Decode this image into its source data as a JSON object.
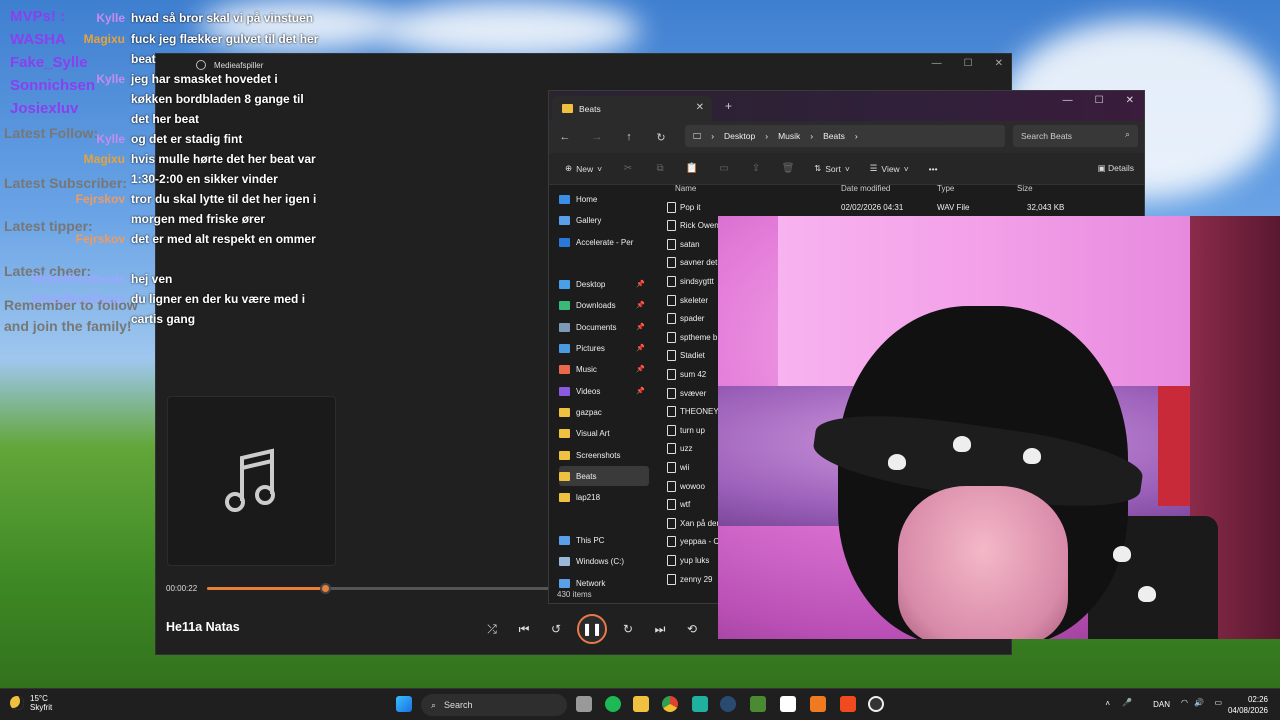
{
  "overlay": {
    "names": [
      "MVPs! :",
      "WASHA",
      "Fake_Sylle",
      "Sonnichsen",
      "Josiexluv"
    ],
    "latest_follow": "Latest Follow:",
    "latest_subscriber": "Latest Subscriber:",
    "latest_tipper": "Latest tipper:",
    "latest_cheer": "Latest cheer:",
    "reminder": "Remember to follow and join the family!"
  },
  "chat": [
    {
      "user": "Kylle",
      "color": "#c58bf0",
      "text": "hvad så bror skal vi på vinstuen"
    },
    {
      "user": "Magixu",
      "color": "#e8a23a",
      "text": "fuck jeg flækker gulvet til det her beat"
    },
    {
      "user": "Kylle",
      "color": "#c58bf0",
      "text": "jeg har smasket hovedet i køkken bordbladen 8 gange til det her beat"
    },
    {
      "user": "Kylle",
      "color": "#c58bf0",
      "text": "og det er stadig fint"
    },
    {
      "user": "Magixu",
      "color": "#e8a23a",
      "text": "hvis mulle hørte det her beat var 1:30-2:00 en sikker vinder"
    },
    {
      "user": "Fejrskov",
      "color": "#f09a60",
      "text": "tror du skal lytte til det her igen i morgen med friske ører"
    },
    {
      "user": "Fejrskov",
      "color": "#f09a60",
      "text": "det er med alt respekt en ommer"
    },
    {
      "user": "WhiteWestDuals",
      "color": "#9aa7ff",
      "text": "hej ven"
    },
    {
      "user": "WhiteWestDuals",
      "color": "#9aa7ff",
      "text": "du ligner en der ku være med i cartis gang"
    }
  ],
  "media_player": {
    "title": "Medieafspiller",
    "elapsed": "00:00:22",
    "progress_fraction": 0.21,
    "track": "He11a Natas",
    "accent": "#e8803a"
  },
  "explorer": {
    "tab_title": "Beats",
    "breadcrumb": [
      "Desktop",
      "Musik",
      "Beats"
    ],
    "search_placeholder": "Search Beats",
    "toolbar": {
      "new": "New",
      "sort": "Sort",
      "view": "View",
      "details": "Details"
    },
    "columns": [
      "Name",
      "Date modified",
      "Type",
      "Size"
    ],
    "sidebar": [
      {
        "label": "Home",
        "color": "#3a8ee6",
        "pin": false
      },
      {
        "label": "Gallery",
        "color": "#5aa0e8",
        "pin": false
      },
      {
        "label": "Accelerate - Per",
        "color": "#2a78d8",
        "pin": false
      },
      {
        "label": "Desktop",
        "color": "#4aa0e8",
        "pin": true
      },
      {
        "label": "Downloads",
        "color": "#3ab87a",
        "pin": true
      },
      {
        "label": "Documents",
        "color": "#7a9ab8",
        "pin": true
      },
      {
        "label": "Pictures",
        "color": "#4a9ae0",
        "pin": true
      },
      {
        "label": "Music",
        "color": "#e86a4a",
        "pin": true
      },
      {
        "label": "Videos",
        "color": "#8a5ae0",
        "pin": true
      },
      {
        "label": "gazpac",
        "color": "#f0c040",
        "pin": false
      },
      {
        "label": "Visual Art",
        "color": "#f0c040",
        "pin": false
      },
      {
        "label": "Screenshots",
        "color": "#f0c040",
        "pin": false
      },
      {
        "label": "Beats",
        "color": "#f0c040",
        "pin": false
      },
      {
        "label": "lap218",
        "color": "#f0c040",
        "pin": false
      },
      {
        "label": "This PC",
        "color": "#5aa0e8",
        "pin": false
      },
      {
        "label": "Windows (C:)",
        "color": "#9ab8d8",
        "pin": false
      },
      {
        "label": "Network",
        "color": "#5aa0e8",
        "pin": false
      }
    ],
    "files": [
      {
        "name": "Pop it",
        "date": "02/02/2026 04:31",
        "type": "WAV File",
        "size": "32,043 KB"
      },
      {
        "name": "Rick Owens"
      },
      {
        "name": "satan"
      },
      {
        "name": "savner det"
      },
      {
        "name": "sindsygttt"
      },
      {
        "name": "skeleter"
      },
      {
        "name": "spader"
      },
      {
        "name": "sptheme b"
      },
      {
        "name": "Stadiet"
      },
      {
        "name": "sum 42"
      },
      {
        "name": "svæver"
      },
      {
        "name": "THEONEYO"
      },
      {
        "name": "turn up"
      },
      {
        "name": "uzz"
      },
      {
        "name": "wii"
      },
      {
        "name": "wowoo"
      },
      {
        "name": "wtf"
      },
      {
        "name": "Xan på der"
      },
      {
        "name": "yeppaa - C"
      },
      {
        "name": "yup luks"
      },
      {
        "name": "zenny 29"
      }
    ],
    "item_count": "430 items"
  },
  "taskbar": {
    "temp": "15°C",
    "condition": "Skyfrit",
    "search": "Search",
    "language": "DAN",
    "time": "02:26",
    "date": "04/08/2026"
  }
}
